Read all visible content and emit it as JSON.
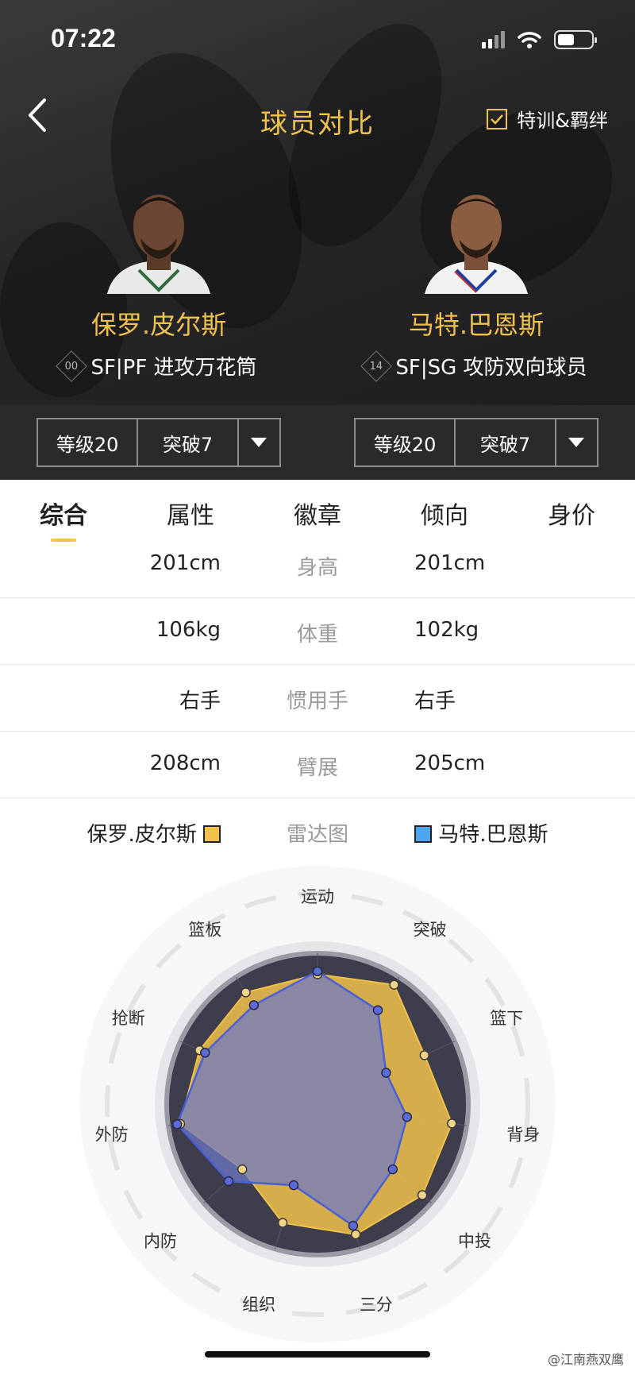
{
  "status": {
    "time": "07:22"
  },
  "header": {
    "title": "球员对比",
    "toggle_label": "特训&羁绊",
    "toggle_checked": true
  },
  "players": [
    {
      "name": "保罗.皮尔斯",
      "number": "00",
      "role": "SF|PF 进攻万花筒",
      "level": "等级20",
      "breakthrough": "突破7",
      "color": "#f0c24b"
    },
    {
      "name": "马特.巴恩斯",
      "number": "14",
      "role": "SF|SG 攻防双向球员",
      "level": "等级20",
      "breakthrough": "突破7",
      "color": "#4aa8f0"
    }
  ],
  "tabs": [
    {
      "label": "综合",
      "active": true
    },
    {
      "label": "属性",
      "active": false
    },
    {
      "label": "徽章",
      "active": false
    },
    {
      "label": "倾向",
      "active": false
    },
    {
      "label": "身价",
      "active": false
    }
  ],
  "stats": [
    {
      "label": "身高",
      "left": "201cm",
      "right": "201cm"
    },
    {
      "label": "体重",
      "left": "106kg",
      "right": "102kg"
    },
    {
      "label": "惯用手",
      "left": "右手",
      "right": "右手"
    },
    {
      "label": "臂展",
      "left": "208cm",
      "right": "205cm"
    }
  ],
  "legend": {
    "left": "保罗.皮尔斯",
    "center": "雷达图",
    "right": "马特.巴恩斯"
  },
  "radar": {
    "axes": [
      "运动",
      "突破",
      "篮下",
      "背身",
      "中投",
      "三分",
      "组织",
      "内防",
      "外防",
      "抢断",
      "篮板"
    ],
    "player1": [
      0.86,
      0.94,
      0.78,
      0.9,
      0.92,
      0.9,
      0.82,
      0.66,
      0.92,
      0.86,
      0.88
    ],
    "player2": [
      0.88,
      0.74,
      0.5,
      0.6,
      0.66,
      0.84,
      0.56,
      0.78,
      0.94,
      0.82,
      0.78
    ]
  },
  "watermark": "@江南燕双鹰"
}
